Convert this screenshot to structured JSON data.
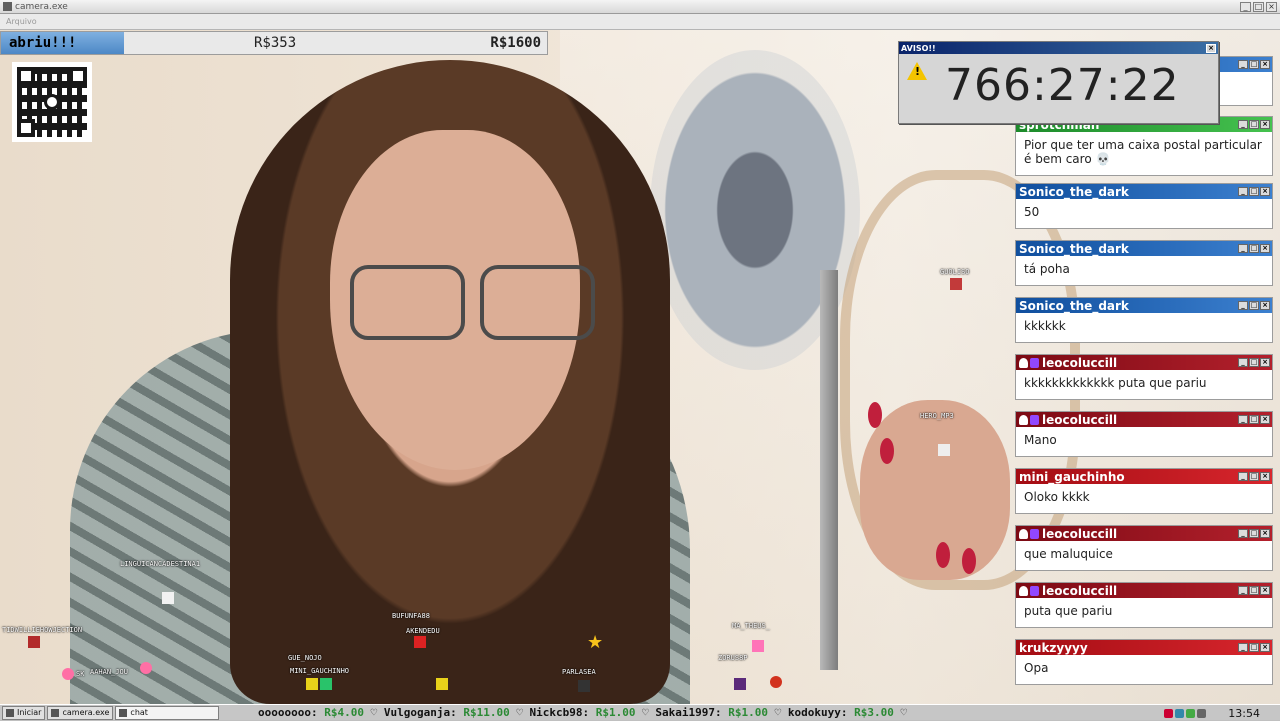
{
  "window": {
    "title": "camera.exe",
    "menu": "Arquivo"
  },
  "stats": {
    "goal_label": "abriu!!!",
    "current": "R$353",
    "target": "R$1600"
  },
  "aviso": {
    "title": "AVISO!!",
    "timer": "766:27:22"
  },
  "chat": [
    {
      "user": "sprotchman",
      "text": "Pior que ter uma caixa postal particular é bem caro 💀",
      "color": "green",
      "icon": "none"
    },
    {
      "user": "Sonico_the_dark",
      "text": "50",
      "color": "blue",
      "icon": "none"
    },
    {
      "user": "Sonico_the_dark",
      "text": "tá poha",
      "color": "blue",
      "icon": "none"
    },
    {
      "user": "Sonico_the_dark",
      "text": "kkkkkk",
      "color": "blue",
      "icon": "none"
    },
    {
      "user": "leocoluccill",
      "text": "kkkkkkkkkkkkk puta que pariu",
      "color": "maroon",
      "icon": "sub-badge"
    },
    {
      "user": "leocoluccill",
      "text": "Mano",
      "color": "maroon",
      "icon": "sub-badge"
    },
    {
      "user": "mini_gauchinho",
      "text": "Oloko kkkk",
      "color": "red",
      "icon": "none"
    },
    {
      "user": "leocoluccill",
      "text": "que maluquice",
      "color": "maroon",
      "icon": "sub-badge"
    },
    {
      "user": "leocoluccill",
      "text": "puta que pariu",
      "color": "maroon",
      "icon": "sub-badge"
    },
    {
      "user": "krukzyyyy",
      "text": "Opa",
      "color": "red",
      "icon": "none"
    }
  ],
  "viewers": [
    "GUOLISO",
    "HERO_MP3",
    "LINGUICANCADESTINA1",
    "TIDWILLIEHOWJECTION",
    "BUFUNFA88",
    "AKENDEDU",
    "GUE_NOJO",
    "MINI_GAUCHINHO",
    "AAHAN_JOU",
    "SK",
    "PARLASEA",
    "MA_THEUS_",
    "ZORUS8P"
  ],
  "taskbar": {
    "start": "Iniciar",
    "app": "camera.exe",
    "chat": "chat",
    "clock": "13:54"
  },
  "ticker": [
    {
      "prefix": "oooooooo: ",
      "amount": "R$4.00"
    },
    {
      "prefix": "♡ Vulgoganja: ",
      "amount": "R$11.00"
    },
    {
      "prefix": "♡ Nickcb98: ",
      "amount": "R$1.00"
    },
    {
      "prefix": "♡ Sakai1997: ",
      "amount": "R$1.00"
    },
    {
      "prefix": "♡ kodokuyy: ",
      "amount": "R$3.00"
    },
    {
      "prefix": "♡",
      "amount": ""
    }
  ],
  "colors": {
    "blue": "#104f9e",
    "green": "#1c8a2a",
    "maroon": "#7c0a14",
    "red": "#a30c13",
    "ticker_amount": "#2c8a35"
  }
}
